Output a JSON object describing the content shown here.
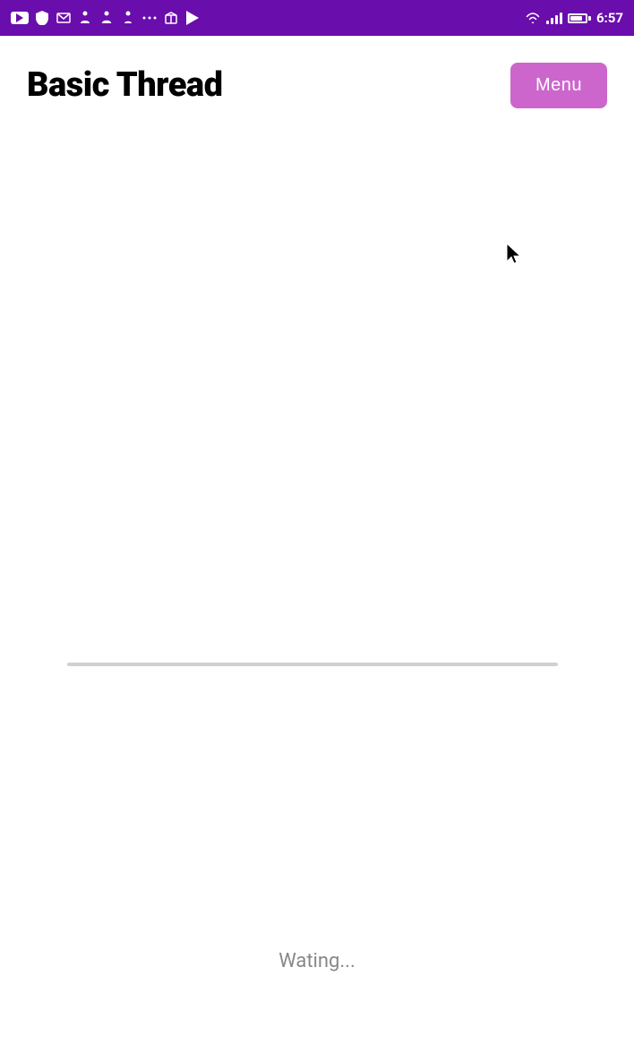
{
  "statusBar": {
    "time": "6:57",
    "icons": [
      "youtube",
      "shield",
      "mail",
      "figure1",
      "figure2",
      "figure3",
      "dots",
      "package",
      "play"
    ]
  },
  "header": {
    "title": "Basic Thread",
    "menuButton": "Menu"
  },
  "content": {
    "waitingText": "Wating..."
  },
  "colors": {
    "purple": "#6a0dad",
    "menuPurple": "#cc66cc",
    "divider": "#d0d0d0",
    "waitingTextColor": "#888888"
  }
}
